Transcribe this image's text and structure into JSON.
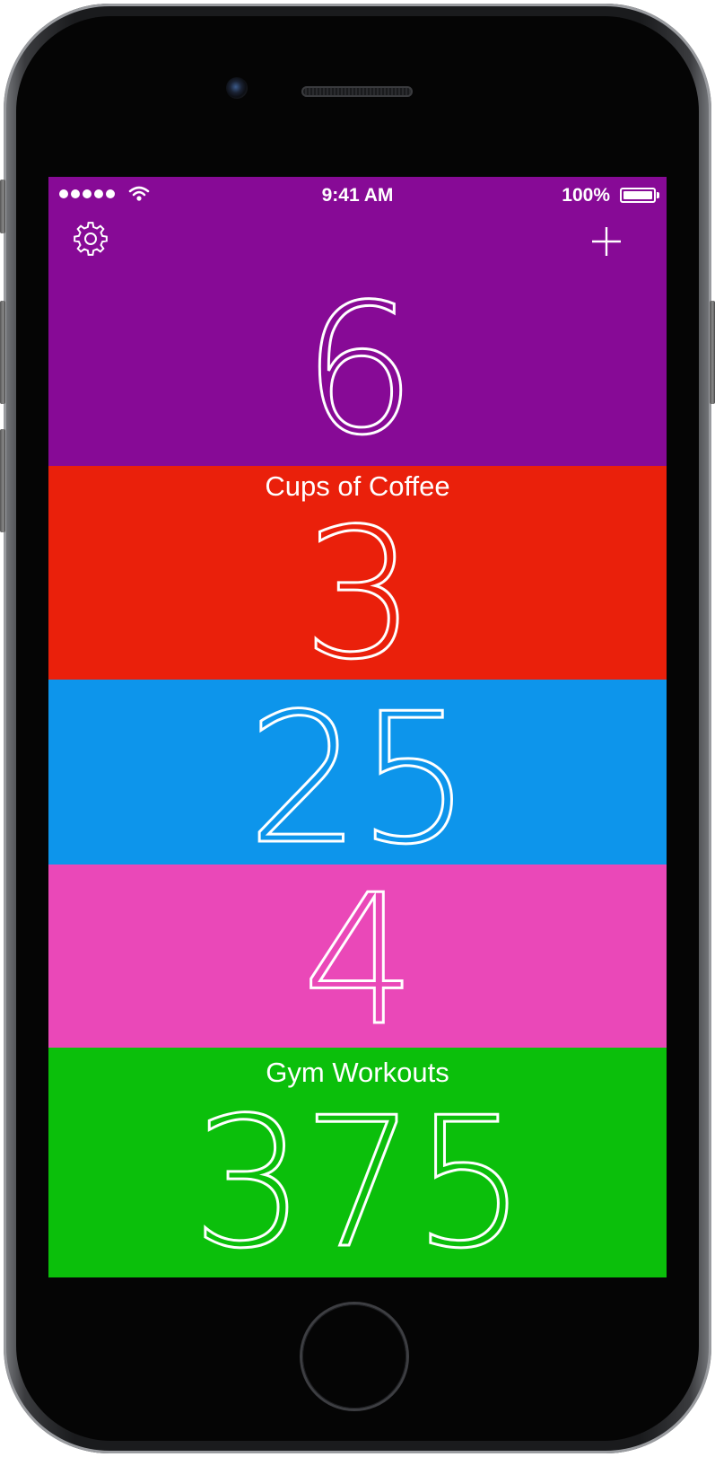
{
  "status_bar": {
    "time": "9:41 AM",
    "battery_percent": "100%",
    "signal_bars": 5,
    "battery_level": 1.0
  },
  "toolbar": {
    "settings_icon": "gear-icon",
    "add_icon": "plus-icon"
  },
  "counters": [
    {
      "value": "6",
      "label": "",
      "color": "#870a96"
    },
    {
      "value": "3",
      "label": "Cups of Coffee",
      "color": "#ea200b"
    },
    {
      "value": "25",
      "label": "",
      "color": "#0d95eb"
    },
    {
      "value": "4",
      "label": "",
      "color": "#ea48b8"
    },
    {
      "value": "375",
      "label": "Gym Workouts",
      "color": "#0bbf0b"
    }
  ]
}
